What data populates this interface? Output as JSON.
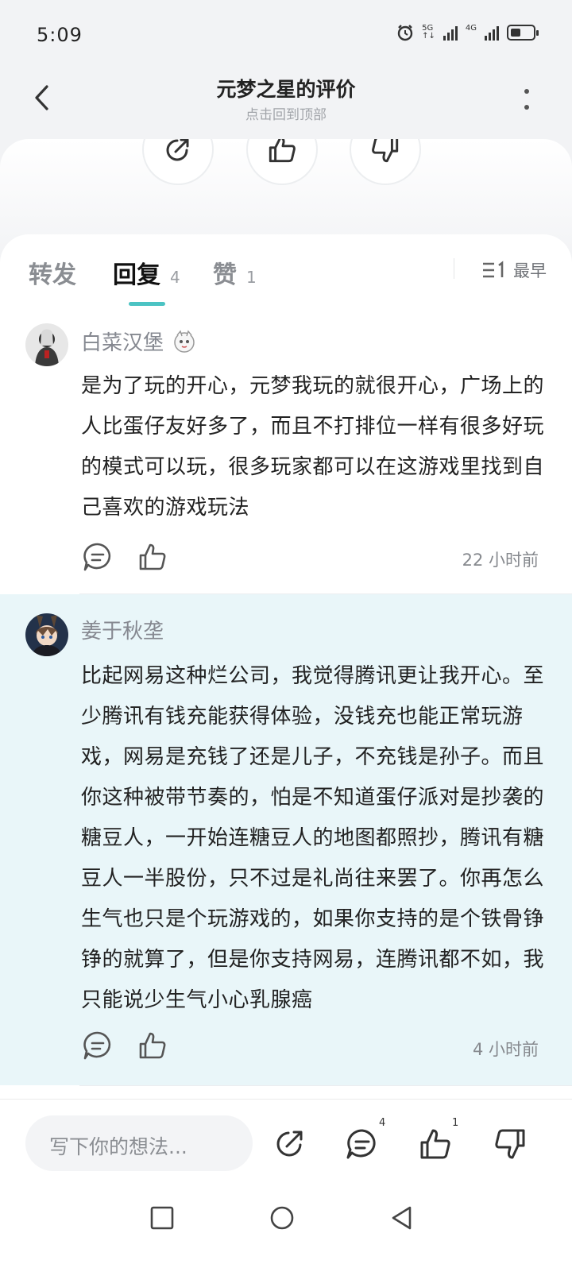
{
  "status_bar": {
    "time": "5:09",
    "net1": "5G",
    "net2": "4G"
  },
  "header": {
    "title": "元梦之星的评价",
    "subtitle": "点击回到顶部"
  },
  "tabs": [
    {
      "label": "转发",
      "count": ""
    },
    {
      "label": "回复",
      "count": "4"
    },
    {
      "label": "赞",
      "count": "1"
    }
  ],
  "sort": {
    "label": "最早"
  },
  "comments": [
    {
      "user": "白菜汉堡",
      "text": "是为了玩的开心，元梦我玩的就很开心，广场上的人比蛋仔友好多了，而且不打排位一样有很多好玩的模式可以玩，很多玩家都可以在这游戏里找到自己喜欢的游戏玩法",
      "time": "22 小时前"
    },
    {
      "user": "姜于秋垄",
      "text": "比起网易这种烂公司，我觉得腾讯更让我开心。至少腾讯有钱充能获得体验，没钱充也能正常玩游戏，网易是充钱了还是儿子，不充钱是孙子。而且你这种被带节奏的，怕是不知道蛋仔派对是抄袭的糖豆人，一开始连糖豆人的地图都照抄，腾讯有糖豆人一半股份，只不过是礼尚往来罢了。你再怎么生气也只是个玩游戏的，如果你支持的是个铁骨铮铮的就算了，但是你支持网易，连腾讯都不如，我只能说少生气小心乳腺癌",
      "time": "4 小时前"
    }
  ],
  "bottom_bar": {
    "input_placeholder": "写下你的想法...",
    "reply_count": "4",
    "like_count": "1"
  },
  "colors": {
    "accent": "#4bc3c3",
    "highlight_bg": "#e9f6f9"
  }
}
